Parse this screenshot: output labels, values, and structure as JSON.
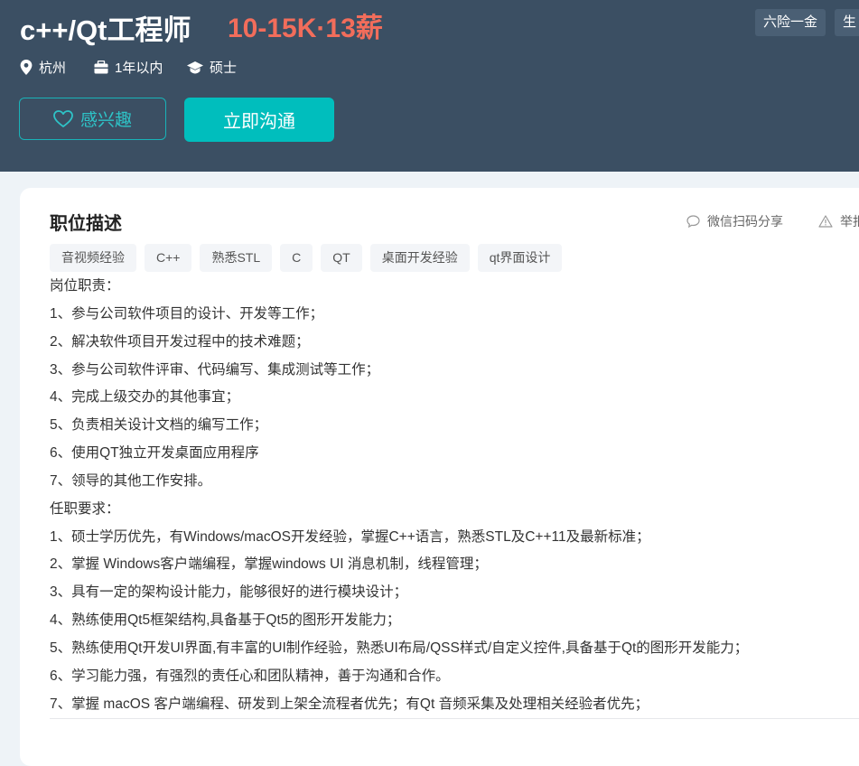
{
  "job": {
    "title": "c++/Qt工程师",
    "salary": "10-15K·13薪",
    "benefits": [
      "六险一金",
      "生"
    ],
    "location": "杭州",
    "experience": "1年以内",
    "degree": "硕士"
  },
  "actions": {
    "interest_label": "感兴趣",
    "chat_label": "立即沟通"
  },
  "description": {
    "section_title": "职位描述",
    "share_label": "微信扫码分享",
    "report_label": "举报",
    "tags": [
      "音视频经验",
      "C++",
      "熟悉STL",
      "C",
      "QT",
      "桌面开发经验",
      "qt界面设计"
    ],
    "lines": [
      "岗位职责：",
      "1、参与公司软件项目的设计、开发等工作；",
      "2、解决软件项目开发过程中的技术难题；",
      "3、参与公司软件评审、代码编写、集成测试等工作；",
      "4、完成上级交办的其他事宜；",
      "5、负责相关设计文档的编写工作；",
      "6、使用QT独立开发桌面应用程序",
      "7、领导的其他工作安排。",
      "任职要求：",
      "1、硕士学历优先，有Windows/macOS开发经验，掌握C++语言，熟悉STL及C++11及最新标准；",
      "2、掌握 Windows客户端编程，掌握windows UI 消息机制，线程管理；",
      "3、具有一定的架构设计能力，能够很好的进行模块设计；",
      "4、熟练使用Qt5框架结构,具备基于Qt5的图形开发能力；",
      "5、熟练使用Qt开发UI界面,有丰富的UI制作经验，熟悉UI布局/QSS样式/自定义控件,具备基于Qt的图形开发能力；",
      "6、学习能力强，有强烈的责任心和团队精神，善于沟通和合作。",
      "7、掌握 macOS 客户端编程、研发到上架全流程者优先；有Qt 音频采集及处理相关经验者优先；"
    ]
  },
  "colors": {
    "header_bg": "#3b4f63",
    "salary": "#f26d5b",
    "accent": "#00bebd"
  }
}
